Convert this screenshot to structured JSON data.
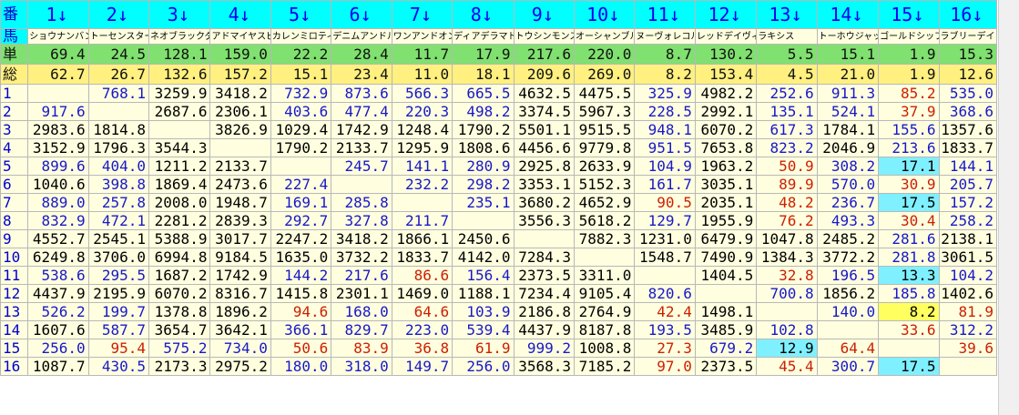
{
  "header": {
    "corner_top": "番",
    "corner_bottom": "馬",
    "labels": [
      "1↓",
      "2↓",
      "3↓",
      "4↓",
      "5↓",
      "6↓",
      "7↓",
      "8↓",
      "9↓",
      "10↓",
      "11↓",
      "12↓",
      "13↓",
      "14↓",
      "15↓",
      "16↓"
    ]
  },
  "horse_names": [
    "ショウナンバンド",
    "トーセンスターダ",
    "ネオブラックダイ",
    "アドマイヤスピカ",
    "カレンミロティッ",
    "デニムアンドルビ",
    "ワンアンドオンリ",
    "ディアデラマドレ",
    "トウシンモンステ",
    "オーシャンブルー",
    "ヌーヴォレコルト",
    "レッドデイヴィス",
    "ラキシス",
    "",
    "トーホウジャッカ",
    "ゴールドシップ",
    "ラブリーデイ"
  ],
  "tansho": {
    "label": "単",
    "values": [
      "69.4",
      "24.5",
      "128.1",
      "159.0",
      "22.2",
      "28.4",
      "11.7",
      "17.9",
      "217.6",
      "220.0",
      "8.7",
      "130.2",
      "5.5",
      "15.1",
      "1.9",
      "15.3"
    ]
  },
  "sougou": {
    "label": "総",
    "values": [
      "62.7",
      "26.7",
      "132.6",
      "157.2",
      "15.1",
      "23.4",
      "11.0",
      "18.1",
      "209.6",
      "269.0",
      "8.2",
      "153.4",
      "4.5",
      "21.0",
      "1.9",
      "12.6"
    ]
  },
  "rows": [
    {
      "label": "1",
      "cells": [
        {
          "v": "",
          "c": "k"
        },
        {
          "v": "768.1",
          "c": "b"
        },
        {
          "v": "3259.9",
          "c": "k"
        },
        {
          "v": "3418.2",
          "c": "k"
        },
        {
          "v": "732.9",
          "c": "b"
        },
        {
          "v": "873.6",
          "c": "b"
        },
        {
          "v": "566.3",
          "c": "b"
        },
        {
          "v": "665.5",
          "c": "b"
        },
        {
          "v": "4632.5",
          "c": "k"
        },
        {
          "v": "4475.5",
          "c": "k"
        },
        {
          "v": "325.9",
          "c": "b"
        },
        {
          "v": "4982.2",
          "c": "k"
        },
        {
          "v": "252.6",
          "c": "b"
        },
        {
          "v": "911.3",
          "c": "b"
        },
        {
          "v": "85.2",
          "c": "r"
        },
        {
          "v": "535.0",
          "c": "b"
        }
      ]
    },
    {
      "label": "2",
      "cells": [
        {
          "v": "917.6",
          "c": "b"
        },
        {
          "v": "",
          "c": "k"
        },
        {
          "v": "2687.6",
          "c": "k"
        },
        {
          "v": "2306.1",
          "c": "k"
        },
        {
          "v": "403.6",
          "c": "b"
        },
        {
          "v": "477.4",
          "c": "b"
        },
        {
          "v": "220.3",
          "c": "b"
        },
        {
          "v": "498.2",
          "c": "b"
        },
        {
          "v": "3374.5",
          "c": "k"
        },
        {
          "v": "5967.3",
          "c": "k"
        },
        {
          "v": "228.5",
          "c": "b"
        },
        {
          "v": "2992.1",
          "c": "k"
        },
        {
          "v": "135.1",
          "c": "b"
        },
        {
          "v": "524.1",
          "c": "b"
        },
        {
          "v": "37.9",
          "c": "r"
        },
        {
          "v": "368.6",
          "c": "b"
        }
      ]
    },
    {
      "label": "3",
      "cells": [
        {
          "v": "2983.6",
          "c": "k"
        },
        {
          "v": "1814.8",
          "c": "k"
        },
        {
          "v": "",
          "c": "k"
        },
        {
          "v": "3826.9",
          "c": "k"
        },
        {
          "v": "1029.4",
          "c": "k"
        },
        {
          "v": "1742.9",
          "c": "k"
        },
        {
          "v": "1248.4",
          "c": "k"
        },
        {
          "v": "1790.2",
          "c": "k"
        },
        {
          "v": "5501.1",
          "c": "k"
        },
        {
          "v": "9515.5",
          "c": "k"
        },
        {
          "v": "948.1",
          "c": "b"
        },
        {
          "v": "6070.2",
          "c": "k"
        },
        {
          "v": "617.3",
          "c": "b"
        },
        {
          "v": "1784.1",
          "c": "k"
        },
        {
          "v": "155.6",
          "c": "b"
        },
        {
          "v": "1357.6",
          "c": "k"
        }
      ]
    },
    {
      "label": "4",
      "cells": [
        {
          "v": "3152.9",
          "c": "k"
        },
        {
          "v": "1796.3",
          "c": "k"
        },
        {
          "v": "3544.3",
          "c": "k"
        },
        {
          "v": "",
          "c": "k"
        },
        {
          "v": "1790.2",
          "c": "k"
        },
        {
          "v": "2133.7",
          "c": "k"
        },
        {
          "v": "1295.9",
          "c": "k"
        },
        {
          "v": "1808.6",
          "c": "k"
        },
        {
          "v": "4456.6",
          "c": "k"
        },
        {
          "v": "9779.8",
          "c": "k"
        },
        {
          "v": "951.5",
          "c": "b"
        },
        {
          "v": "7653.8",
          "c": "k"
        },
        {
          "v": "823.2",
          "c": "b"
        },
        {
          "v": "2046.9",
          "c": "k"
        },
        {
          "v": "213.6",
          "c": "b"
        },
        {
          "v": "1833.7",
          "c": "k"
        }
      ]
    },
    {
      "label": "5",
      "cells": [
        {
          "v": "899.6",
          "c": "b"
        },
        {
          "v": "404.0",
          "c": "b"
        },
        {
          "v": "1211.2",
          "c": "k"
        },
        {
          "v": "2133.7",
          "c": "k"
        },
        {
          "v": "",
          "c": "k"
        },
        {
          "v": "245.7",
          "c": "b"
        },
        {
          "v": "141.1",
          "c": "b"
        },
        {
          "v": "280.9",
          "c": "b"
        },
        {
          "v": "2925.8",
          "c": "k"
        },
        {
          "v": "2633.9",
          "c": "k"
        },
        {
          "v": "104.9",
          "c": "b"
        },
        {
          "v": "1963.2",
          "c": "k"
        },
        {
          "v": "50.9",
          "c": "r"
        },
        {
          "v": "308.2",
          "c": "b"
        },
        {
          "v": "17.1",
          "c": "k",
          "h": "c"
        },
        {
          "v": "144.1",
          "c": "b"
        }
      ]
    },
    {
      "label": "6",
      "cells": [
        {
          "v": "1040.6",
          "c": "k"
        },
        {
          "v": "398.8",
          "c": "b"
        },
        {
          "v": "1869.4",
          "c": "k"
        },
        {
          "v": "2473.6",
          "c": "k"
        },
        {
          "v": "227.4",
          "c": "b"
        },
        {
          "v": "",
          "c": "k"
        },
        {
          "v": "232.2",
          "c": "b"
        },
        {
          "v": "298.2",
          "c": "b"
        },
        {
          "v": "3353.1",
          "c": "k"
        },
        {
          "v": "5152.3",
          "c": "k"
        },
        {
          "v": "161.7",
          "c": "b"
        },
        {
          "v": "3035.1",
          "c": "k"
        },
        {
          "v": "89.9",
          "c": "r"
        },
        {
          "v": "570.0",
          "c": "b"
        },
        {
          "v": "30.9",
          "c": "r"
        },
        {
          "v": "205.7",
          "c": "b"
        }
      ]
    },
    {
      "label": "7",
      "cells": [
        {
          "v": "889.0",
          "c": "b"
        },
        {
          "v": "257.8",
          "c": "b"
        },
        {
          "v": "2008.0",
          "c": "k"
        },
        {
          "v": "1948.7",
          "c": "k"
        },
        {
          "v": "169.1",
          "c": "b"
        },
        {
          "v": "285.8",
          "c": "b"
        },
        {
          "v": "",
          "c": "k"
        },
        {
          "v": "235.1",
          "c": "b"
        },
        {
          "v": "3680.2",
          "c": "k"
        },
        {
          "v": "4652.9",
          "c": "k"
        },
        {
          "v": "90.5",
          "c": "r"
        },
        {
          "v": "2035.1",
          "c": "k"
        },
        {
          "v": "48.2",
          "c": "r"
        },
        {
          "v": "236.7",
          "c": "b"
        },
        {
          "v": "17.5",
          "c": "k",
          "h": "c"
        },
        {
          "v": "157.2",
          "c": "b"
        }
      ]
    },
    {
      "label": "8",
      "cells": [
        {
          "v": "832.9",
          "c": "b"
        },
        {
          "v": "472.1",
          "c": "b"
        },
        {
          "v": "2281.2",
          "c": "k"
        },
        {
          "v": "2839.3",
          "c": "k"
        },
        {
          "v": "292.7",
          "c": "b"
        },
        {
          "v": "327.8",
          "c": "b"
        },
        {
          "v": "211.7",
          "c": "b"
        },
        {
          "v": "",
          "c": "k"
        },
        {
          "v": "3556.3",
          "c": "k"
        },
        {
          "v": "5618.2",
          "c": "k"
        },
        {
          "v": "129.7",
          "c": "b"
        },
        {
          "v": "1955.9",
          "c": "k"
        },
        {
          "v": "76.2",
          "c": "r"
        },
        {
          "v": "493.3",
          "c": "b"
        },
        {
          "v": "30.4",
          "c": "r"
        },
        {
          "v": "258.2",
          "c": "b"
        }
      ]
    },
    {
      "label": "9",
      "cells": [
        {
          "v": "4552.7",
          "c": "k"
        },
        {
          "v": "2545.1",
          "c": "k"
        },
        {
          "v": "5388.9",
          "c": "k"
        },
        {
          "v": "3017.7",
          "c": "k"
        },
        {
          "v": "2247.2",
          "c": "k"
        },
        {
          "v": "3418.2",
          "c": "k"
        },
        {
          "v": "1866.1",
          "c": "k"
        },
        {
          "v": "2450.6",
          "c": "k"
        },
        {
          "v": "",
          "c": "k"
        },
        {
          "v": "7882.3",
          "c": "k"
        },
        {
          "v": "1231.0",
          "c": "k"
        },
        {
          "v": "6479.9",
          "c": "k"
        },
        {
          "v": "1047.8",
          "c": "k"
        },
        {
          "v": "2485.2",
          "c": "k"
        },
        {
          "v": "281.6",
          "c": "b"
        },
        {
          "v": "2138.1",
          "c": "k"
        }
      ]
    },
    {
      "label": "10",
      "cells": [
        {
          "v": "6249.8",
          "c": "k"
        },
        {
          "v": "3706.0",
          "c": "k"
        },
        {
          "v": "6994.8",
          "c": "k"
        },
        {
          "v": "9184.5",
          "c": "k"
        },
        {
          "v": "1635.0",
          "c": "k"
        },
        {
          "v": "3732.2",
          "c": "k"
        },
        {
          "v": "1833.7",
          "c": "k"
        },
        {
          "v": "4142.0",
          "c": "k"
        },
        {
          "v": "7284.3",
          "c": "k"
        },
        {
          "v": "",
          "c": "k"
        },
        {
          "v": "1548.7",
          "c": "k"
        },
        {
          "v": "7490.9",
          "c": "k"
        },
        {
          "v": "1384.3",
          "c": "k"
        },
        {
          "v": "3772.2",
          "c": "k"
        },
        {
          "v": "281.8",
          "c": "b"
        },
        {
          "v": "3061.5",
          "c": "k"
        }
      ]
    },
    {
      "label": "11",
      "cells": [
        {
          "v": "538.6",
          "c": "b"
        },
        {
          "v": "295.5",
          "c": "b"
        },
        {
          "v": "1687.2",
          "c": "k"
        },
        {
          "v": "1742.9",
          "c": "k"
        },
        {
          "v": "144.2",
          "c": "b"
        },
        {
          "v": "217.6",
          "c": "b"
        },
        {
          "v": "86.6",
          "c": "r"
        },
        {
          "v": "156.4",
          "c": "b"
        },
        {
          "v": "2373.5",
          "c": "k"
        },
        {
          "v": "3311.0",
          "c": "k"
        },
        {
          "v": "",
          "c": "k"
        },
        {
          "v": "1404.5",
          "c": "k"
        },
        {
          "v": "32.8",
          "c": "r"
        },
        {
          "v": "196.5",
          "c": "b"
        },
        {
          "v": "13.3",
          "c": "k",
          "h": "c"
        },
        {
          "v": "104.2",
          "c": "b"
        }
      ]
    },
    {
      "label": "12",
      "cells": [
        {
          "v": "4437.9",
          "c": "k"
        },
        {
          "v": "2195.9",
          "c": "k"
        },
        {
          "v": "6070.2",
          "c": "k"
        },
        {
          "v": "8316.7",
          "c": "k"
        },
        {
          "v": "1415.8",
          "c": "k"
        },
        {
          "v": "2301.1",
          "c": "k"
        },
        {
          "v": "1469.0",
          "c": "k"
        },
        {
          "v": "1188.1",
          "c": "k"
        },
        {
          "v": "7234.4",
          "c": "k"
        },
        {
          "v": "9105.4",
          "c": "k"
        },
        {
          "v": "820.6",
          "c": "b"
        },
        {
          "v": "",
          "c": "k"
        },
        {
          "v": "700.8",
          "c": "b"
        },
        {
          "v": "1856.2",
          "c": "k"
        },
        {
          "v": "185.8",
          "c": "b"
        },
        {
          "v": "1402.6",
          "c": "k"
        }
      ]
    },
    {
      "label": "13",
      "cells": [
        {
          "v": "526.2",
          "c": "b"
        },
        {
          "v": "199.7",
          "c": "b"
        },
        {
          "v": "1378.8",
          "c": "k"
        },
        {
          "v": "1896.2",
          "c": "k"
        },
        {
          "v": "94.6",
          "c": "r"
        },
        {
          "v": "168.0",
          "c": "b"
        },
        {
          "v": "64.6",
          "c": "r"
        },
        {
          "v": "103.9",
          "c": "b"
        },
        {
          "v": "2186.8",
          "c": "k"
        },
        {
          "v": "2764.9",
          "c": "k"
        },
        {
          "v": "42.4",
          "c": "r"
        },
        {
          "v": "1498.1",
          "c": "k"
        },
        {
          "v": "",
          "c": "k"
        },
        {
          "v": "140.0",
          "c": "b"
        },
        {
          "v": "8.2",
          "c": "k",
          "h": "y"
        },
        {
          "v": "81.9",
          "c": "r"
        }
      ]
    },
    {
      "label": "14",
      "cells": [
        {
          "v": "1607.6",
          "c": "k"
        },
        {
          "v": "587.7",
          "c": "b"
        },
        {
          "v": "3654.7",
          "c": "k"
        },
        {
          "v": "3642.1",
          "c": "k"
        },
        {
          "v": "366.1",
          "c": "b"
        },
        {
          "v": "829.7",
          "c": "b"
        },
        {
          "v": "223.0",
          "c": "b"
        },
        {
          "v": "539.4",
          "c": "b"
        },
        {
          "v": "4437.9",
          "c": "k"
        },
        {
          "v": "8187.8",
          "c": "k"
        },
        {
          "v": "193.5",
          "c": "b"
        },
        {
          "v": "3485.9",
          "c": "k"
        },
        {
          "v": "102.8",
          "c": "b"
        },
        {
          "v": "",
          "c": "k"
        },
        {
          "v": "33.6",
          "c": "r"
        },
        {
          "v": "312.2",
          "c": "b"
        }
      ]
    },
    {
      "label": "15",
      "cells": [
        {
          "v": "256.0",
          "c": "b"
        },
        {
          "v": "95.4",
          "c": "r"
        },
        {
          "v": "575.2",
          "c": "b"
        },
        {
          "v": "734.0",
          "c": "b"
        },
        {
          "v": "50.6",
          "c": "r"
        },
        {
          "v": "83.9",
          "c": "r"
        },
        {
          "v": "36.8",
          "c": "r"
        },
        {
          "v": "61.9",
          "c": "r"
        },
        {
          "v": "999.2",
          "c": "b"
        },
        {
          "v": "1008.8",
          "c": "k"
        },
        {
          "v": "27.3",
          "c": "r"
        },
        {
          "v": "679.2",
          "c": "b"
        },
        {
          "v": "12.9",
          "c": "k",
          "h": "c"
        },
        {
          "v": "64.4",
          "c": "r"
        },
        {
          "v": "",
          "c": "k"
        },
        {
          "v": "39.6",
          "c": "r"
        }
      ]
    },
    {
      "label": "16",
      "cells": [
        {
          "v": "1087.7",
          "c": "k"
        },
        {
          "v": "430.5",
          "c": "b"
        },
        {
          "v": "2173.3",
          "c": "k"
        },
        {
          "v": "2975.2",
          "c": "k"
        },
        {
          "v": "180.0",
          "c": "b"
        },
        {
          "v": "318.0",
          "c": "b"
        },
        {
          "v": "149.7",
          "c": "b"
        },
        {
          "v": "256.0",
          "c": "b"
        },
        {
          "v": "3568.3",
          "c": "k"
        },
        {
          "v": "7185.2",
          "c": "k"
        },
        {
          "v": "97.0",
          "c": "r"
        },
        {
          "v": "2373.5",
          "c": "k"
        },
        {
          "v": "45.4",
          "c": "r"
        },
        {
          "v": "300.7",
          "c": "b"
        },
        {
          "v": "17.5",
          "c": "k",
          "h": "c"
        },
        {
          "v": "",
          "c": "k"
        }
      ]
    }
  ]
}
